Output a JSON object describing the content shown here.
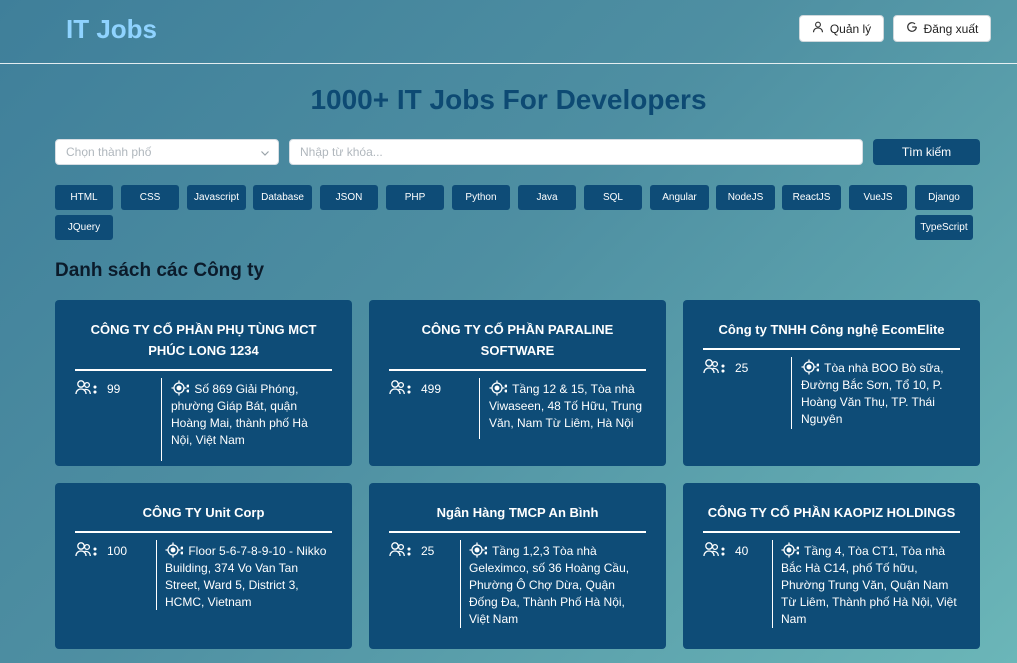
{
  "header": {
    "logo": "IT Jobs",
    "manage_label": "Quản lý",
    "logout_label": "Đăng xuất"
  },
  "hero": {
    "title": "1000+ IT Jobs For Developers"
  },
  "search": {
    "city_placeholder": "Chọn thành phố",
    "keyword_placeholder": "Nhập từ khóa...",
    "button_label": "Tìm kiếm"
  },
  "tags": [
    "HTML",
    "CSS",
    "Javascript",
    "Database",
    "JSON",
    "PHP",
    "Python",
    "Java",
    "SQL",
    "Angular",
    "NodeJS",
    "ReactJS",
    "VueJS",
    "Django",
    "JQuery",
    "TypeScript"
  ],
  "companies_section": {
    "title": "Danh sách các Công ty"
  },
  "companies": [
    {
      "name": "CÔNG TY CỔ PHẦN PHỤ TÙNG MCT PHÚC LONG 1234",
      "employees": "99",
      "address": "Số 869 Giải Phóng, phường Giáp Bát, quận Hoàng Mai, thành phố Hà Nội, Việt Nam"
    },
    {
      "name": "CÔNG TY CỔ PHẦN PARALINE SOFTWARE",
      "employees": "499",
      "address": "Tầng 12 & 15, Tòa nhà Viwaseen, 48 Tố Hữu, Trung Văn, Nam Từ Liêm, Hà Nội"
    },
    {
      "name": "Công ty TNHH Công nghệ EcomElite",
      "employees": "25",
      "address": "Tòa nhà BOO Bò sữa, Đường Bắc Sơn, Tổ 10, P. Hoàng Văn Thụ, TP. Thái Nguyên"
    },
    {
      "name": "CÔNG TY Unit Corp",
      "employees": "100",
      "address": "Floor 5-6-7-8-9-10 - Nikko Building, 374 Vo Van Tan Street, Ward 5, District 3, HCMC, Vietnam"
    },
    {
      "name": "Ngân Hàng TMCP An Bình",
      "employees": "25",
      "address": "Tầng 1,2,3 Tòa nhà Geleximco, số 36 Hoàng Cầu, Phường Ô Chợ Dừa, Quận Đống Đa, Thành Phố Hà Nội, Việt Nam"
    },
    {
      "name": "CÔNG TY CỔ PHẦN KAOPIZ HOLDINGS",
      "employees": "40",
      "address": "Tầng 4, Tòa CT1, Tòa nhà Bắc Hà C14, phố Tố hữu, Phường Trung Văn, Quận Nam Từ Liêm, Thành phố Hà Nội, Việt Nam"
    }
  ],
  "colors": {
    "primary": "#0e4c77",
    "logo": "#8fd3ff",
    "hero_title": "#0d4a73"
  },
  "icons": {
    "manage": "user-icon",
    "logout": "google-icon",
    "employees": "users-icon",
    "address": "location-crosshair-icon",
    "select": "chevron-down-icon"
  }
}
